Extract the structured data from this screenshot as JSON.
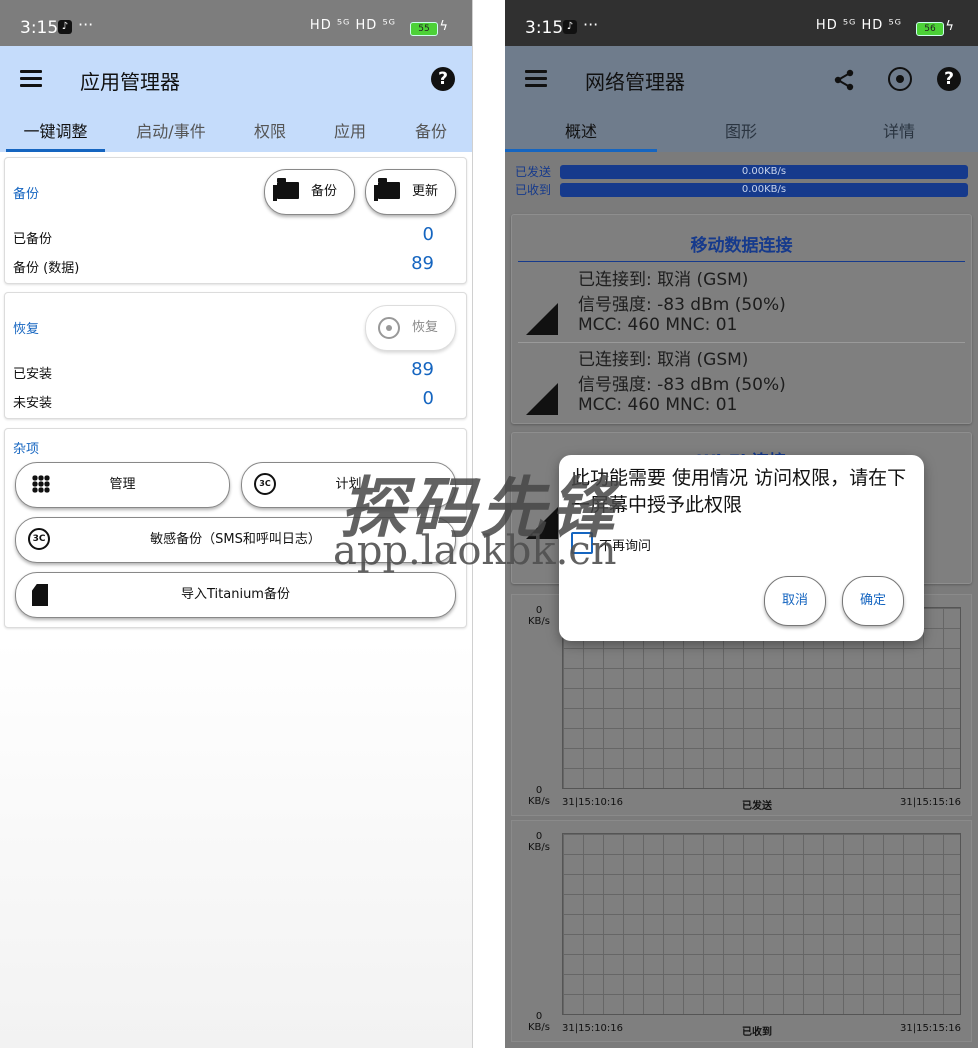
{
  "left": {
    "status": {
      "time": "3:15",
      "dots": "···",
      "signal": "HD ⁵ᴳ HD ⁵ᴳ",
      "battery": "55"
    },
    "appbar": {
      "title": "应用管理器"
    },
    "tabs": [
      "一键调整",
      "启动/事件",
      "权限",
      "应用",
      "备份"
    ],
    "backup": {
      "title": "备份",
      "backup_button": "备份",
      "update_button": "更新",
      "rows": [
        {
          "label": "已备份",
          "value": "0"
        },
        {
          "label": "备份 (数据)",
          "value": "89"
        }
      ]
    },
    "restore": {
      "title": "恢复",
      "restore_button": "恢复",
      "rows": [
        {
          "label": "已安装",
          "value": "89"
        },
        {
          "label": "未安装",
          "value": "0"
        }
      ]
    },
    "misc": {
      "title": "杂项",
      "manage_button": "管理",
      "schedule_button": "计划",
      "sensitive_button": "敏感备份（SMS和呼叫日志）",
      "import_button": "导入Titanium备份"
    }
  },
  "right": {
    "status": {
      "time": "3:15",
      "dots": "···",
      "signal": "HD ⁵ᴳ HD ⁵ᴳ",
      "battery": "56"
    },
    "appbar": {
      "title": "网络管理器"
    },
    "tabs": [
      "概述",
      "图形",
      "详情"
    ],
    "rates": {
      "sent_label": "已发送",
      "sent_value": "0.00KB/s",
      "recv_label": "已收到",
      "recv_value": "0.00KB/s"
    },
    "mobile": {
      "title": "移动数据连接",
      "connections": [
        {
          "line1": "已连接到: 取消 (GSM)",
          "line2": "信号强度: -83 dBm (50%)",
          "line3": "MCC: 460 MNC: 01"
        },
        {
          "line1": "已连接到: 取消 (GSM)",
          "line2": "信号强度: -83 dBm (50%)",
          "line3": "MCC: 460 MNC: 01"
        }
      ]
    },
    "wifi": {
      "title": "Wi-Fi 连接"
    },
    "charts": [
      {
        "y_top": "0",
        "y_top_unit": "KB/s",
        "y_bottom": "0",
        "y_bottom_unit": "KB/s",
        "t_start": "31|15:10:16",
        "t_end": "31|15:15:16",
        "label": "已发送"
      },
      {
        "y_top": "0",
        "y_top_unit": "KB/s",
        "y_bottom": "0",
        "y_bottom_unit": "KB/s",
        "t_start": "31|15:10:16",
        "t_end": "31|15:15:16",
        "label": "已收到"
      }
    ],
    "dialog": {
      "message": "此功能需要 使用情况 访问权限，请在下一屏幕中授予此权限",
      "checkbox_label": "不再询问",
      "cancel_button": "取消",
      "ok_button": "确定"
    }
  },
  "watermark": {
    "text": "探码先锋",
    "url": "app.laokbk.cn"
  },
  "colors": {
    "accent": "#1565c0",
    "appbar_left": "#c5dcfb",
    "scrim": "#7b7b7b"
  }
}
